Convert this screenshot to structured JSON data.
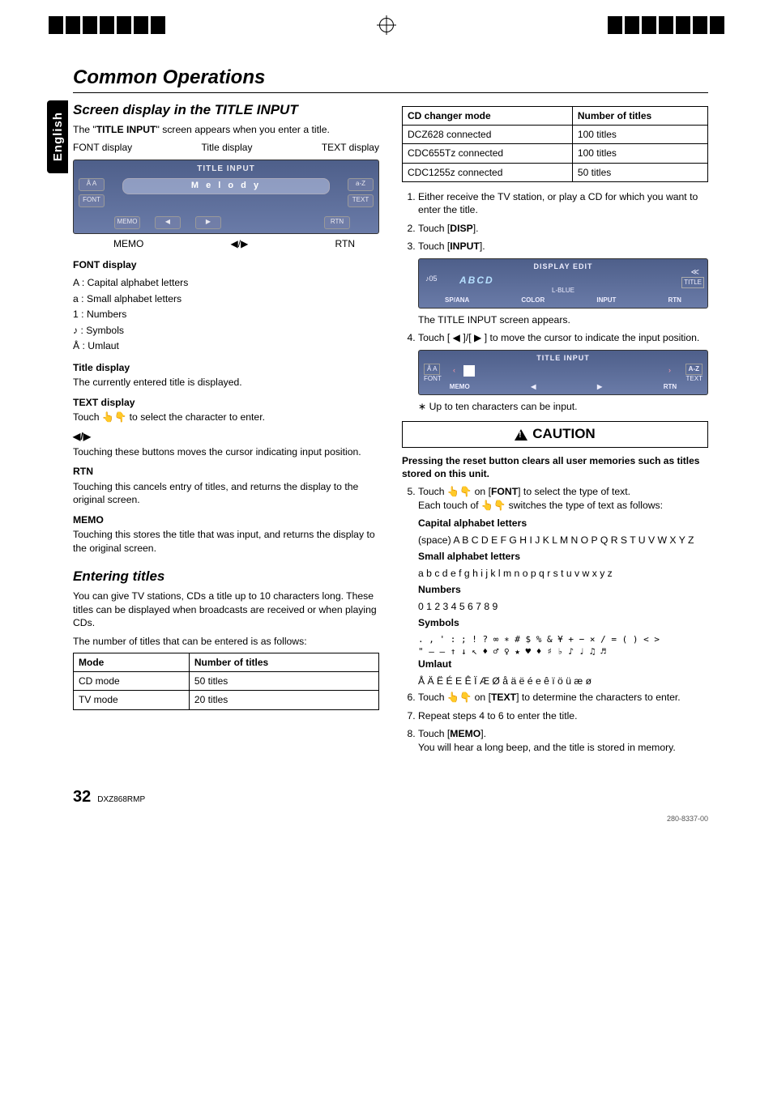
{
  "sideTab": "English",
  "pageTitle": "Common Operations",
  "left": {
    "h2": "Screen display in the TITLE INPUT",
    "intro_a": "The \"",
    "intro_b": "TITLE INPUT",
    "intro_c": "\" screen appears when you enter a title.",
    "labels": {
      "font": "FONT display",
      "title": "Title display",
      "text": "TEXT display"
    },
    "screen": {
      "titleBar": "TITLE INPUT",
      "titleValue": "M e l o d y",
      "leftBtnTop": "Å A",
      "leftBtnBot": "FONT",
      "rightBtnTop": "a-Z",
      "rightBtnBot": "TEXT",
      "memo": "MEMO",
      "rtn": "RTN"
    },
    "bottomLabels": {
      "memo": "MEMO",
      "arrows": "◀/▶",
      "rtn": "RTN"
    },
    "fontDisplayHdr": "FONT display",
    "fontList": [
      {
        "k": "A :",
        "v": "Capital alphabet letters"
      },
      {
        "k": "a :",
        "v": "Small alphabet letters"
      },
      {
        "k": "1 :",
        "v": "Numbers"
      },
      {
        "k": "♪ :",
        "v": "Symbols"
      },
      {
        "k": "Å :",
        "v": "Umlaut"
      }
    ],
    "titleDispHdr": "Title display",
    "titleDispBody": "The currently entered title is displayed.",
    "textDispHdr": "TEXT display",
    "textDispBody": "Touch 👆👇 to select the character to enter.",
    "arrowsHdr": "◀/▶",
    "arrowsBody": "Touching these buttons moves the cursor indicating input position.",
    "rtnHdr": "RTN",
    "rtnBody": "Touching this cancels entry of titles, and returns the display to the original screen.",
    "memoHdr": "MEMO",
    "memoBody": "Touching this stores the title that was input, and returns the display to the original screen.",
    "h2b": "Entering titles",
    "enterP1": "You can give TV stations, CDs a title up to 10 characters long. These titles can be displayed when broadcasts are received or when playing CDs.",
    "enterP2": "The number of titles that can be entered is as follows:",
    "table1": {
      "headers": [
        "Mode",
        "Number of titles"
      ],
      "rows": [
        [
          "CD mode",
          "50 titles"
        ],
        [
          "TV mode",
          "20 titles"
        ]
      ]
    }
  },
  "right": {
    "table2": {
      "headers": [
        "CD changer mode",
        "Number of titles"
      ],
      "rows": [
        [
          "DCZ628 connected",
          "100 titles"
        ],
        [
          "CDC655Tz connected",
          "100 titles"
        ],
        [
          "CDC1255z connected",
          "50 titles"
        ]
      ]
    },
    "step1": "Either receive the TV station, or play a CD for which you want to enter the title.",
    "step2a": "Touch [",
    "step2b": "DISP",
    "step2c": "].",
    "step3a": "Touch [",
    "step3b": "INPUT",
    "step3c": "].",
    "screen3": {
      "hdr": "DISPLAY EDIT",
      "trk": "05",
      "title": "ABCD",
      "sub1": "L-BLUE",
      "r1": "SP/ANA",
      "r2": "COLOR",
      "r3": "INPUT",
      "r4": "RTN",
      "side": "TITLE"
    },
    "step3note": "The TITLE INPUT screen appears.",
    "step4": "Touch [ ◀ ]/[ ▶ ] to move the cursor to indicate the input position.",
    "screen4": {
      "hdr": "TITLE INPUT",
      "left": "Å A",
      "leftB": "FONT",
      "right": "A-Z",
      "rightB": "TEXT",
      "b1": "MEMO",
      "b4": "RTN"
    },
    "step4note": "∗ Up to ten characters can be input.",
    "caution": "CAUTION",
    "cautionNote": "Pressing the reset button clears all user memories such as titles stored on this unit.",
    "step5a": "Touch 👆👇 on [",
    "step5b": "FONT",
    "step5c": "] to select the type of text.",
    "step5d": "Each touch of 👆👇 switches the type of text as follows:",
    "cap": "Capital alphabet letters",
    "capV": "(space) A B C D E F G H I J K L M N O P Q R S T U V W X Y Z",
    "sml": "Small alphabet letters",
    "smlV": "a b c d e f g h i j k l m n o p q r s t u v w x y z",
    "num": "Numbers",
    "numV": "0 1 2 3 4 5 6 7 8 9",
    "sym": "Symbols",
    "symV1": ". , ' : ; ! ? ∞ ∗ # $ % & ¥ + − × / = ( ) < >",
    "symV2": "\" — – ↑ ↓ ↖ ♦ ♂ ♀ ★ ♥ ♦ ♯ ♭ ♪ ♩ ♫ ♬",
    "uml": "Umlaut",
    "umlV": "Å Ä Ë É E Ê Ï Æ Ø å ä ë é e ê ï ö ü æ ø",
    "step6a": "Touch 👆👇 on [",
    "step6b": "TEXT",
    "step6c": "] to determine the characters to enter.",
    "step7": "Repeat steps 4 to 6 to enter the title.",
    "step8a": "Touch [",
    "step8b": "MEMO",
    "step8c": "].",
    "step8d": "You will hear a long beep, and the title is stored in memory."
  },
  "footer": {
    "page": "32",
    "model": "DXZ868RMP",
    "part": "280-8337-00"
  }
}
